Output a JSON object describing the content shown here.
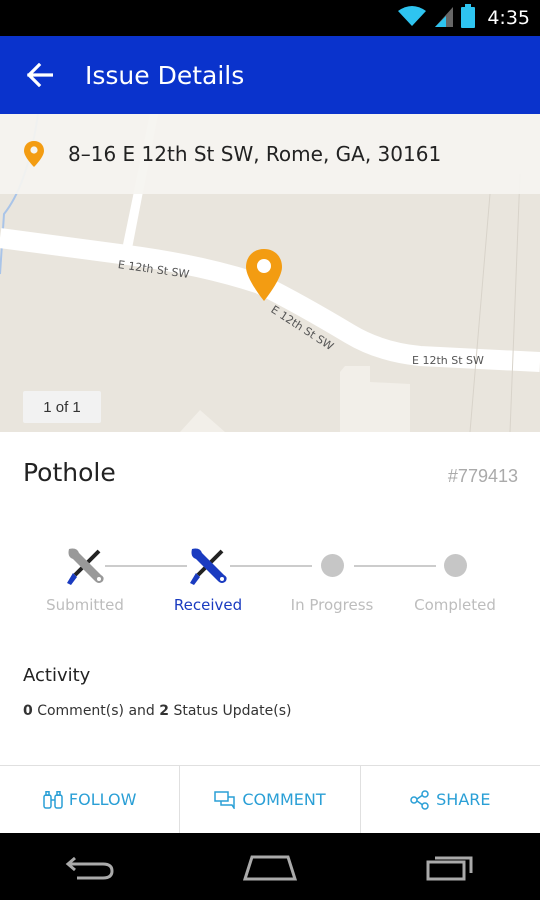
{
  "status_bar": {
    "time": "4:35",
    "icons": [
      "wifi-icon",
      "signal-icon",
      "battery-icon"
    ]
  },
  "app_bar": {
    "title": "Issue Details",
    "back_icon": "arrow-left-icon",
    "background": "#0a33cc"
  },
  "map": {
    "address": "8–16  E 12th St SW, Rome, GA, 30161",
    "street_labels": [
      "E 12th St SW",
      "E 12th St SW",
      "E 12th St SW"
    ],
    "photo_count": "1 of 1",
    "marker_color": "#f39c12"
  },
  "issue": {
    "title": "Pothole",
    "id": "#779413"
  },
  "progress": {
    "steps": [
      {
        "label": "Submitted",
        "state": "done",
        "icon": "wrench-screwdriver-icon"
      },
      {
        "label": "Received",
        "state": "current",
        "icon": "wrench-screwdriver-icon"
      },
      {
        "label": "In Progress",
        "state": "pending",
        "icon": "dot-icon"
      },
      {
        "label": "Completed",
        "state": "pending",
        "icon": "dot-icon"
      }
    ],
    "active_color": "#1a3bc0"
  },
  "activity": {
    "title": "Activity",
    "comment_count": "0",
    "comments_text": "Comment(s) and",
    "status_update_count": "2",
    "status_updates_text": "Status Update(s)"
  },
  "actions": {
    "follow": "FOLLOW",
    "comment": "COMMENT",
    "share": "SHARE",
    "color": "#2a9fd6"
  },
  "nav_bar": {
    "icons": [
      "back-nav-icon",
      "home-nav-icon",
      "recents-nav-icon"
    ]
  }
}
